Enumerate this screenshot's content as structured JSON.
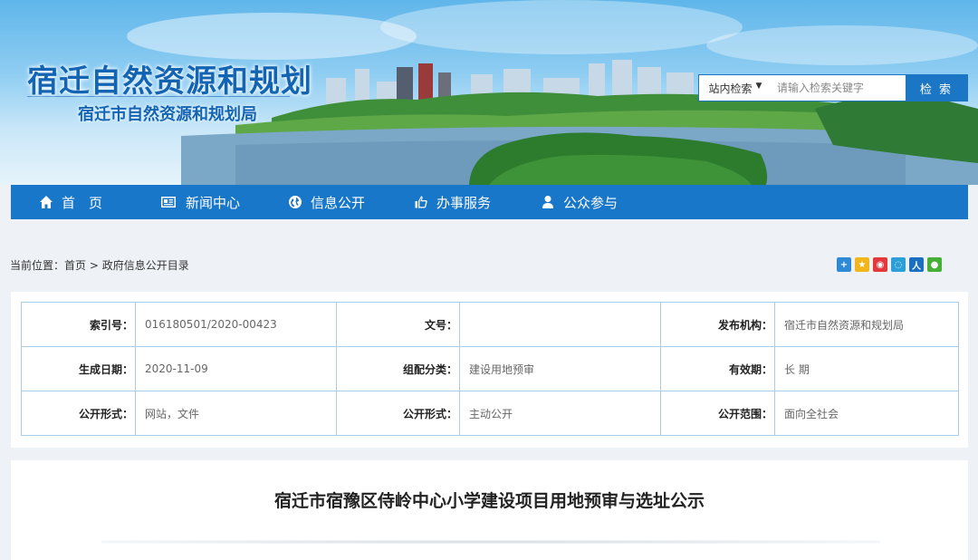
{
  "header": {
    "site_title": "宿迁自然资源和规划",
    "site_subtitle": "宿迁市自然资源和规划局"
  },
  "search": {
    "scope_label": "站内检索",
    "placeholder": "请输入检索关键字",
    "button_label": "检 索"
  },
  "nav": {
    "items": [
      {
        "label": "首　页",
        "icon": "home-icon"
      },
      {
        "label": "新闻中心",
        "icon": "newspaper-icon"
      },
      {
        "label": "信息公开",
        "icon": "globe-icon"
      },
      {
        "label": "办事服务",
        "icon": "thumbs-up-icon"
      },
      {
        "label": "公众参与",
        "icon": "user-icon"
      }
    ]
  },
  "breadcrumb": {
    "prefix": "当前位置：",
    "home": "首页",
    "separator": " > ",
    "current": "政府信息公开目录"
  },
  "share": {
    "icons": [
      "plus-share-icon",
      "qzone-icon",
      "weibo-icon",
      "tencent-weibo-icon",
      "renren-icon",
      "wechat-icon"
    ],
    "colors": [
      "#2f8ad6",
      "#f2b51c",
      "#e4393c",
      "#2a9fd8",
      "#1a6fc1",
      "#45b035"
    ]
  },
  "info": {
    "rows": [
      [
        {
          "label": "索引号：",
          "value": "016180501/2020-00423"
        },
        {
          "label": "文号：",
          "value": ""
        },
        {
          "label": "发布机构：",
          "value": "宿迁市自然资源和规划局"
        }
      ],
      [
        {
          "label": "生成日期：",
          "value": "2020-11-09"
        },
        {
          "label": "组配分类：",
          "value": "建设用地预审"
        },
        {
          "label": "有效期：",
          "value": "长 期"
        }
      ],
      [
        {
          "label": "公开形式：",
          "value": "网站，文件"
        },
        {
          "label": "公开形式：",
          "value": "主动公开"
        },
        {
          "label": "公开范围：",
          "value": "面向全社会"
        }
      ]
    ]
  },
  "article": {
    "title": "宿迁市宿豫区侍岭中心小学建设项目用地预审与选址公示"
  }
}
